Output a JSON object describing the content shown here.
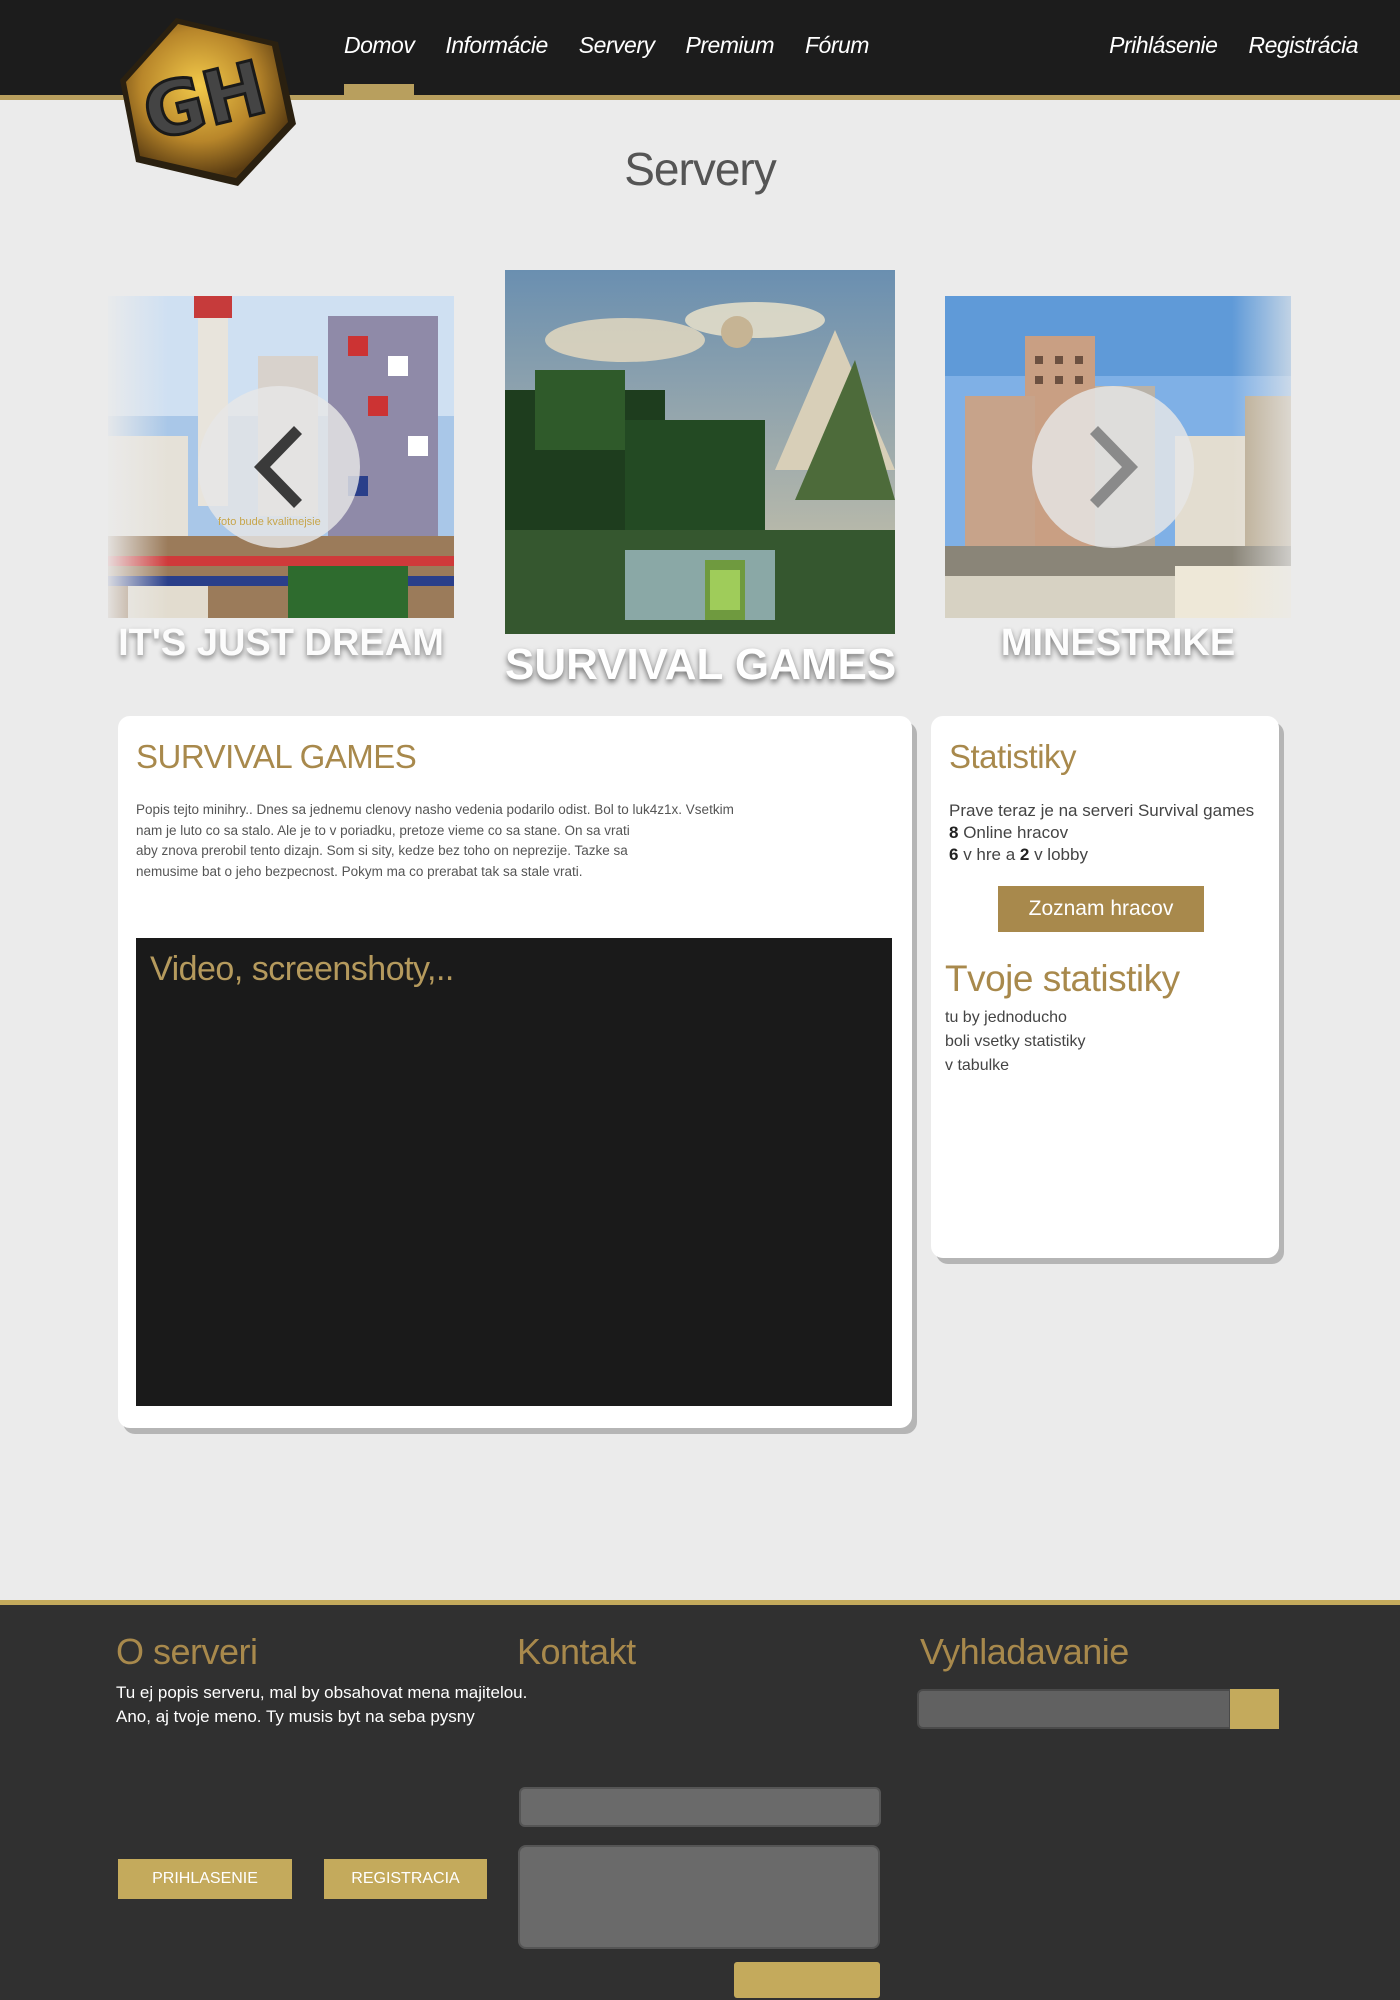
{
  "logo": {
    "text": "GH"
  },
  "nav": {
    "items": [
      {
        "label": "Domov",
        "active": true
      },
      {
        "label": "Informácie"
      },
      {
        "label": "Servery"
      },
      {
        "label": "Premium"
      },
      {
        "label": "Fórum"
      }
    ],
    "login": "Prihlásenie",
    "register": "Registrácia"
  },
  "page": {
    "title": "Servery"
  },
  "carousel": {
    "slides": [
      {
        "caption": "IT'S JUST DREAM",
        "overlay_note": "foto bude kvalitnejsie"
      },
      {
        "caption": "SURVIVAL GAMES"
      },
      {
        "caption": "MINESTRIKE"
      }
    ],
    "prev_icon": "chevron-left-icon",
    "next_icon": "chevron-right-icon"
  },
  "server": {
    "title": "SURVIVAL GAMES",
    "description_lines": [
      "Popis tejto minihry.. Dnes sa jednemu clenovy nasho vedenia podarilo odist. Bol to luk4z1x. Vsetkim",
      "nam je luto co sa stalo. Ale je to v poriadku, pretoze vieme co sa stane. On sa vrati",
      "aby znova prerobil tento dizajn. Som si sity, kedze bez toho on neprezije. Tazke sa",
      "nemusime bat o jeho bezpecnost. Pokym ma co prerabat tak sa stale vrati."
    ],
    "media_label": "Video, screenshoty,.."
  },
  "stats": {
    "title": "Statistiky",
    "intro": "Prave teraz je na serveri Survival games",
    "online_count": "8",
    "online_label": " Online hracov",
    "in_game_count": "6",
    "in_game_label": " v hre a ",
    "lobby_count": "2",
    "lobby_label": " v lobby",
    "players_button": "Zoznam hracov",
    "your_title": "Tvoje statistiky",
    "your_lines": [
      "tu by jednoducho",
      "boli vsetky statistiky",
      "v tabulke"
    ]
  },
  "footer": {
    "about_title": "O serveri",
    "about_lines": [
      "Tu ej popis serveru, mal by obsahovat mena majitelou.",
      "Ano, aj tvoje meno. Ty musis byt na seba pysny"
    ],
    "login_button": "PRIHLASENIE",
    "register_button": "REGISTRACIA",
    "contact_title": "Kontakt",
    "search_title": "Vyhladavanie"
  },
  "colors": {
    "accent": "#a8894c",
    "accent_light": "#c4aa5c",
    "header_bg": "#1c1c1c",
    "footer_bg": "#303030",
    "page_bg": "#ebebeb"
  }
}
